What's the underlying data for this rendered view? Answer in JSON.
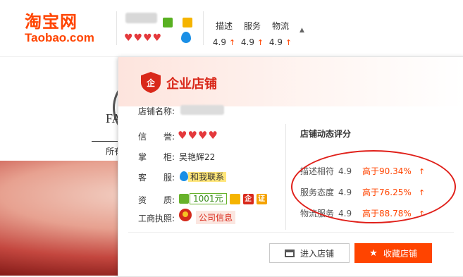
{
  "logo": {
    "cn": "淘宝网",
    "en": "Taobao.com"
  },
  "header_scores": [
    {
      "label": "描述",
      "value": "4.9",
      "arrow": "↑"
    },
    {
      "label": "服务",
      "value": "4.9",
      "arrow": "↑"
    },
    {
      "label": "物流",
      "value": "4.9",
      "arrow": "↑"
    }
  ],
  "header_hearts": "♥♥♥♥",
  "header_caret": "▲",
  "background": {
    "brand_text": "FA",
    "nav_text": "所有"
  },
  "panel": {
    "title": "企业店铺",
    "shield_glyph": "企",
    "shop_name_label": "店铺名称:",
    "credit_label": "信　　誉:",
    "credit_hearts": "♥♥♥♥",
    "owner_label": "掌　　柜:",
    "owner_value": "吴艳辉22",
    "service_label": "客　　服:",
    "service_contact": "和我联系",
    "qual_label": "资　　质:",
    "deposit": "1001元",
    "qual_badges": [
      "企",
      "证"
    ],
    "license_label": "工商执照:",
    "license_value": "公司信息",
    "rating_title": "店铺动态评分",
    "ratings": [
      {
        "label": "描述相符",
        "score": "4.9",
        "percent": "高于90.34%",
        "arrow": "↑"
      },
      {
        "label": "服务态度",
        "score": "4.9",
        "percent": "高于76.25%",
        "arrow": "↑"
      },
      {
        "label": "物流服务",
        "score": "4.9",
        "percent": "高于88.78%",
        "arrow": "↑"
      }
    ],
    "enter_button": "进入店铺",
    "fav_button": "收藏店铺",
    "fav_icon": "★"
  },
  "colors": {
    "brand": "#ff4400",
    "accent_red": "#d9281a",
    "highlight": "#ffe67a"
  }
}
